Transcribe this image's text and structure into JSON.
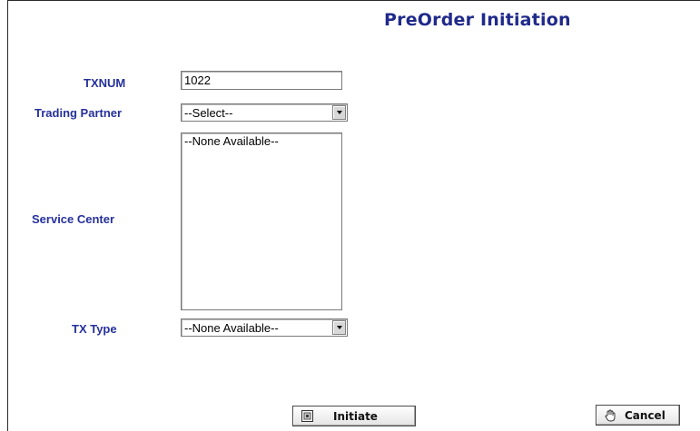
{
  "page": {
    "title": "PreOrder Initiation"
  },
  "form": {
    "txnum": {
      "label": "TXNUM",
      "value": "1022"
    },
    "trading_partner": {
      "label": "Trading Partner",
      "selected": "--Select--"
    },
    "service_center": {
      "label": "Service Center",
      "options": [
        "--None Available--"
      ]
    },
    "tx_type": {
      "label": "TX Type",
      "selected": "--None Available--"
    }
  },
  "actions": {
    "initiate_label": "Initiate",
    "cancel_label": "Cancel"
  },
  "colors": {
    "label": "#25319a",
    "title": "#1f2a8a"
  },
  "icons": {
    "initiate": "document-icon",
    "cancel": "hand-pointer-icon"
  }
}
